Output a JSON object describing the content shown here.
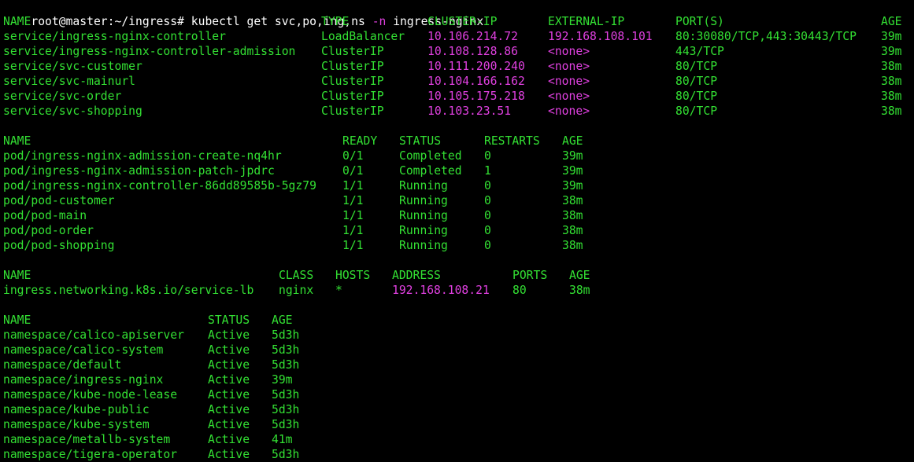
{
  "colors": {
    "background": "#000000",
    "text": "#33e033",
    "ip": "#e040e0",
    "prompt": "#ffffff"
  },
  "prompt": {
    "user_host": "root@master:~/ingress#",
    "command": "kubectl get svc,po,ing,ns",
    "option": "-n",
    "argument": "ingress-nginx"
  },
  "svc": {
    "headers": [
      "NAME",
      "TYPE",
      "CLUSTER-IP",
      "EXTERNAL-IP",
      "PORT(S)",
      "AGE"
    ],
    "rows": [
      [
        "service/ingress-nginx-controller",
        "LoadBalancer",
        "10.106.214.72",
        "192.168.108.101",
        "80:30080/TCP,443:30443/TCP",
        "39m"
      ],
      [
        "service/ingress-nginx-controller-admission",
        "ClusterIP",
        "10.108.128.86",
        "<none>",
        "443/TCP",
        "39m"
      ],
      [
        "service/svc-customer",
        "ClusterIP",
        "10.111.200.240",
        "<none>",
        "80/TCP",
        "38m"
      ],
      [
        "service/svc-mainurl",
        "ClusterIP",
        "10.104.166.162",
        "<none>",
        "80/TCP",
        "38m"
      ],
      [
        "service/svc-order",
        "ClusterIP",
        "10.105.175.218",
        "<none>",
        "80/TCP",
        "38m"
      ],
      [
        "service/svc-shopping",
        "ClusterIP",
        "10.103.23.51",
        "<none>",
        "80/TCP",
        "38m"
      ]
    ]
  },
  "pod": {
    "headers": [
      "NAME",
      "READY",
      "STATUS",
      "RESTARTS",
      "AGE"
    ],
    "rows": [
      [
        "pod/ingress-nginx-admission-create-nq4hr",
        "0/1",
        "Completed",
        "0",
        "39m"
      ],
      [
        "pod/ingress-nginx-admission-patch-jpdrc",
        "0/1",
        "Completed",
        "1",
        "39m"
      ],
      [
        "pod/ingress-nginx-controller-86dd89585b-5gz79",
        "1/1",
        "Running",
        "0",
        "39m"
      ],
      [
        "pod/pod-customer",
        "1/1",
        "Running",
        "0",
        "38m"
      ],
      [
        "pod/pod-main",
        "1/1",
        "Running",
        "0",
        "38m"
      ],
      [
        "pod/pod-order",
        "1/1",
        "Running",
        "0",
        "38m"
      ],
      [
        "pod/pod-shopping",
        "1/1",
        "Running",
        "0",
        "38m"
      ]
    ]
  },
  "ing": {
    "headers": [
      "NAME",
      "CLASS",
      "HOSTS",
      "ADDRESS",
      "PORTS",
      "AGE"
    ],
    "rows": [
      [
        "ingress.networking.k8s.io/service-lb",
        "nginx",
        "*",
        "192.168.108.21",
        "80",
        "38m"
      ]
    ]
  },
  "ns": {
    "headers": [
      "NAME",
      "STATUS",
      "AGE"
    ],
    "rows": [
      [
        "namespace/calico-apiserver",
        "Active",
        "5d3h"
      ],
      [
        "namespace/calico-system",
        "Active",
        "5d3h"
      ],
      [
        "namespace/default",
        "Active",
        "5d3h"
      ],
      [
        "namespace/ingress-nginx",
        "Active",
        "39m"
      ],
      [
        "namespace/kube-node-lease",
        "Active",
        "5d3h"
      ],
      [
        "namespace/kube-public",
        "Active",
        "5d3h"
      ],
      [
        "namespace/kube-system",
        "Active",
        "5d3h"
      ],
      [
        "namespace/metallb-system",
        "Active",
        "41m"
      ],
      [
        "namespace/tigera-operator",
        "Active",
        "5d3h"
      ]
    ]
  }
}
